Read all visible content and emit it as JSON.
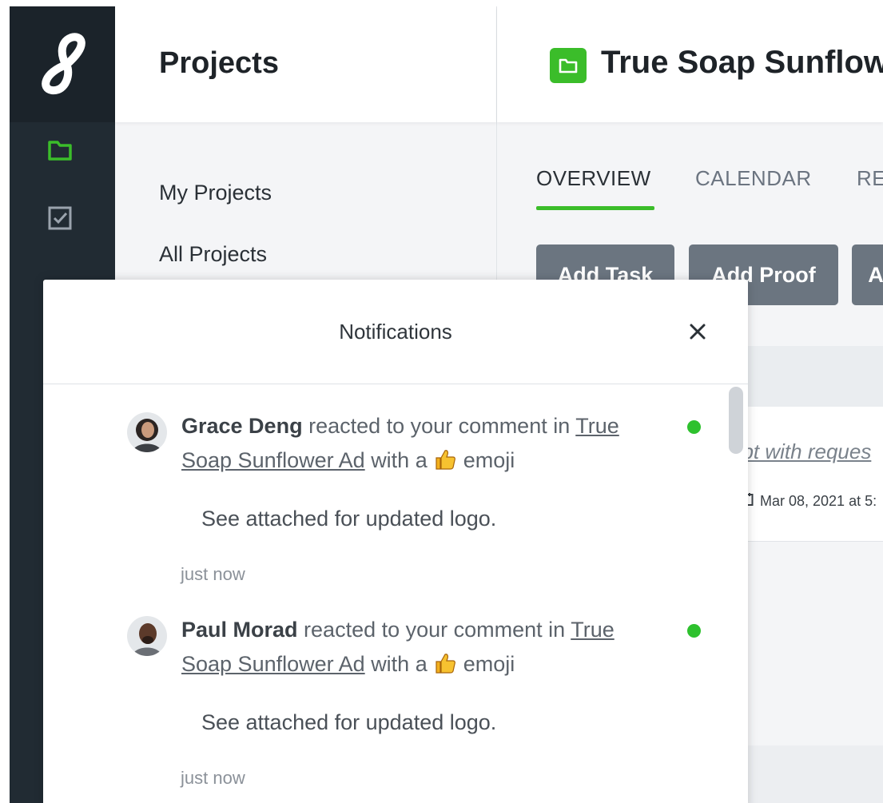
{
  "sidebar": {
    "title": "Projects",
    "links": [
      "My Projects",
      "All Projects"
    ]
  },
  "project": {
    "title": "True Soap Sunflow",
    "tabs": [
      "OVERVIEW",
      "CALENDAR",
      "RE"
    ],
    "actions": [
      "Add Task",
      "Add Proof",
      "A"
    ],
    "card_text": "ept with reques",
    "card_date": "Mar 08, 2021 at 5:"
  },
  "notifications": {
    "title": "Notifications",
    "items": [
      {
        "user": "Grace Deng",
        "action": "reacted to your comment in",
        "project_link": "True Soap Sunflower Ad",
        "with_text": "with a",
        "emoji_text": "emoji",
        "comment": "See attached for updated logo.",
        "time": "just now"
      },
      {
        "user": "Paul Morad",
        "action": "reacted to your comment in",
        "project_link": "True Soap Sunflower Ad",
        "with_text": "with a",
        "emoji_text": "emoji",
        "comment": "See attached for updated logo.",
        "time": "just now"
      }
    ]
  },
  "colors": {
    "brand_green": "#3bbd2a",
    "rail": "#212b33",
    "unread_dot": "#2ec12e",
    "button_gray": "#6b7580"
  },
  "icons": [
    "logo-icon",
    "folder-icon",
    "checkbox-icon",
    "close-icon",
    "thumbs-up-icon",
    "calendar-icon"
  ]
}
